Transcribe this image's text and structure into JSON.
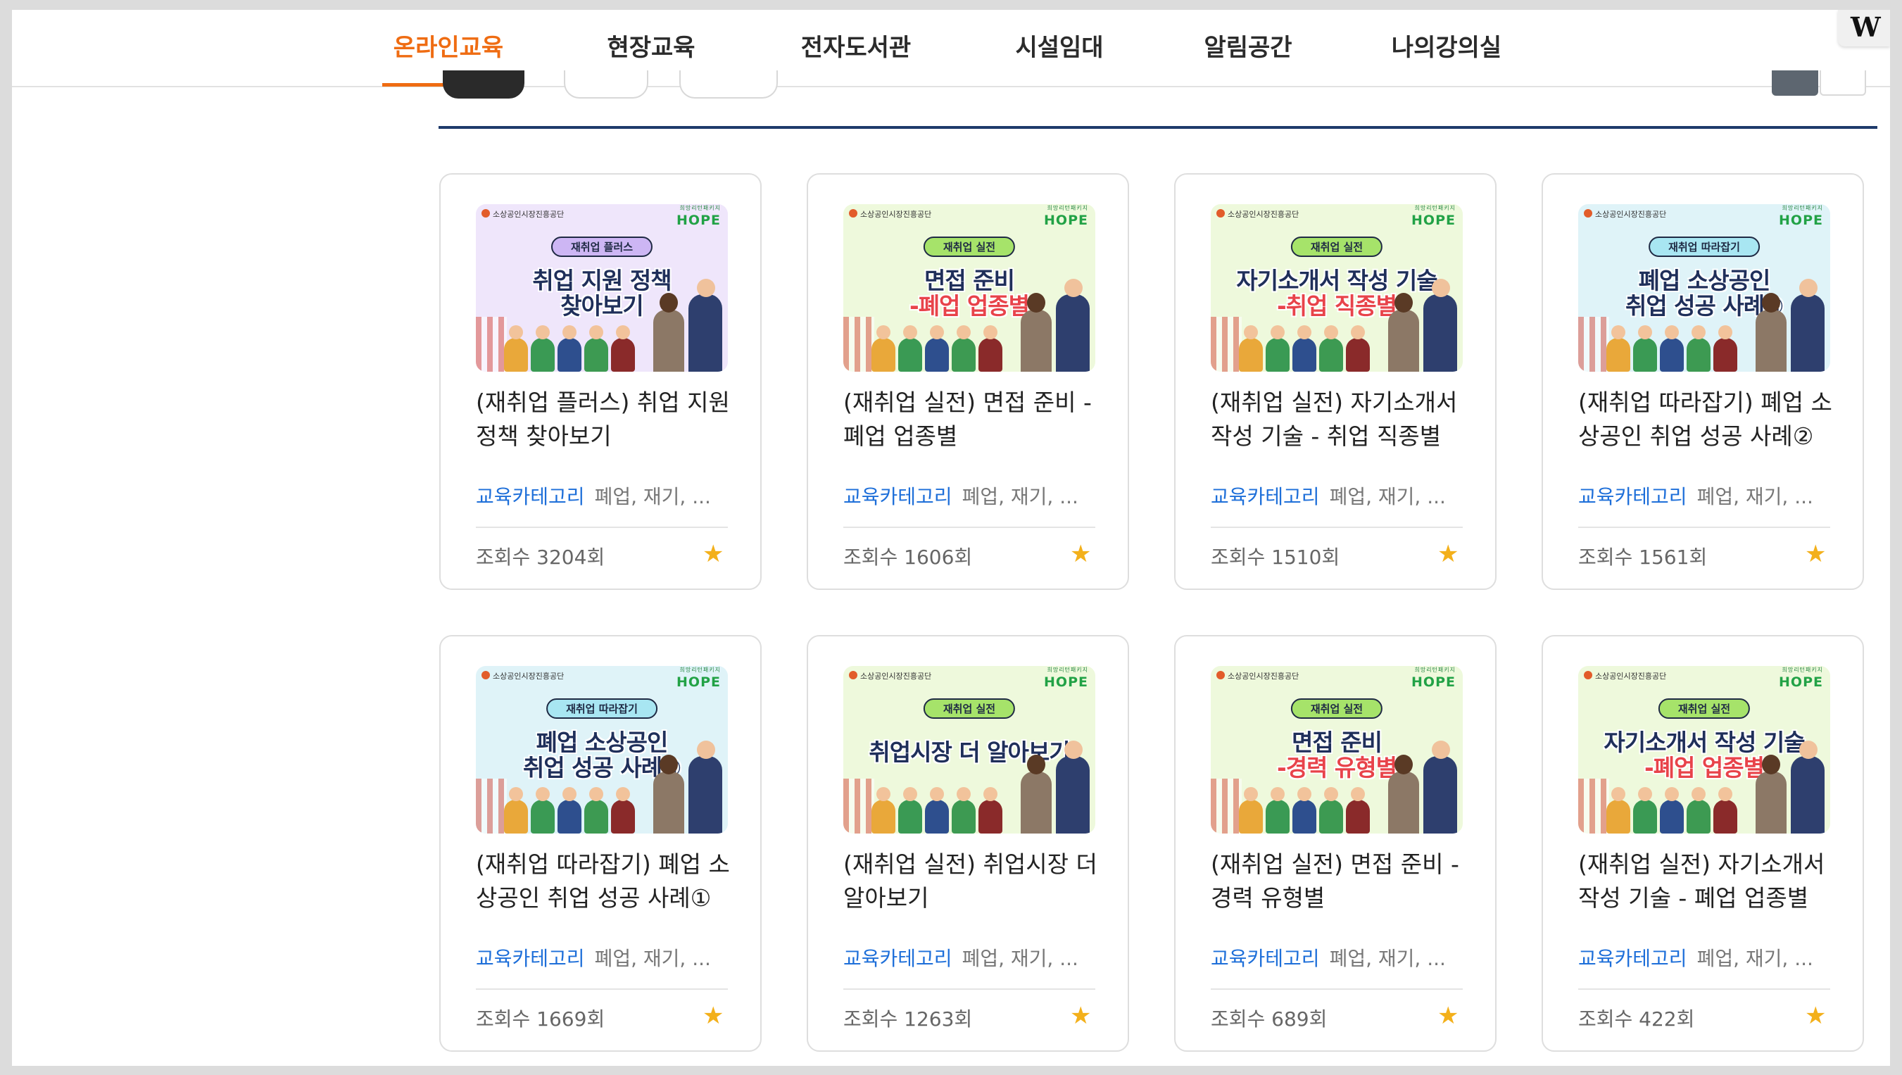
{
  "nav": {
    "items": [
      {
        "label": "온라인교육",
        "active": true
      },
      {
        "label": "현장교육",
        "active": false
      },
      {
        "label": "전자도서관",
        "active": false
      },
      {
        "label": "시설임대",
        "active": false
      },
      {
        "label": "알림공간",
        "active": false
      },
      {
        "label": "나의강의실",
        "active": false
      }
    ],
    "active_color": "#ef6c12"
  },
  "corner_logo": "W",
  "thumbnail_common": {
    "org": "소상공인시장진흥공단",
    "brand": "HOPE",
    "brand_sub": "희망리턴패키지"
  },
  "cards": [
    {
      "thumb_tag": "재취업 플러스",
      "thumb_line1": "취업 지원 정책",
      "thumb_line2": "찾아보기",
      "thumb_bg": "#efe6fb",
      "title": "(재취업 플러스) 취업 지원 정책 찾아보기",
      "category": "교육카테고리",
      "tags": "폐업, 재기, ...",
      "views": "조회수 3204회",
      "favorite": true
    },
    {
      "thumb_tag": "재취업 실전",
      "thumb_line1": "면접 준비",
      "thumb_line2": "-폐업 업종별",
      "thumb_bg": "#eef9dc",
      "title": "(재취업 실전) 면접 준비 - 폐업 업종별",
      "category": "교육카테고리",
      "tags": "폐업, 재기, ...",
      "views": "조회수 1606회",
      "favorite": true
    },
    {
      "thumb_tag": "재취업 실전",
      "thumb_line1": "자기소개서 작성 기술",
      "thumb_line2": "-취업 직종별",
      "thumb_bg": "#eef9dc",
      "title": "(재취업 실전) 자기소개서 작성 기술 - 취업 직종별",
      "category": "교육카테고리",
      "tags": "폐업, 재기, ...",
      "views": "조회수 1510회",
      "favorite": true
    },
    {
      "thumb_tag": "재취업 따라잡기",
      "thumb_line1": "폐업 소상공인",
      "thumb_line2": "취업 성공 사례②",
      "thumb_bg": "#dff3f8",
      "title": "(재취업 따라잡기) 폐업 소상공인 취업 성공 사례②",
      "category": "교육카테고리",
      "tags": "폐업, 재기, ...",
      "views": "조회수 1561회",
      "favorite": true
    },
    {
      "thumb_tag": "재취업 따라잡기",
      "thumb_line1": "폐업 소상공인",
      "thumb_line2": "취업 성공 사례①",
      "thumb_bg": "#dff3f8",
      "title": "(재취업 따라잡기) 폐업 소상공인 취업 성공 사례①",
      "category": "교육카테고리",
      "tags": "폐업, 재기, ...",
      "views": "조회수 1669회",
      "favorite": true
    },
    {
      "thumb_tag": "재취업 실전",
      "thumb_line1": "취업시장 더 알아보기",
      "thumb_line2": "",
      "thumb_bg": "#eef9dc",
      "title": "(재취업 실전) 취업시장 더 알아보기",
      "category": "교육카테고리",
      "tags": "폐업, 재기, ...",
      "views": "조회수 1263회",
      "favorite": true
    },
    {
      "thumb_tag": "재취업 실전",
      "thumb_line1": "면접 준비",
      "thumb_line2": "-경력 유형별",
      "thumb_bg": "#eef9dc",
      "title": "(재취업 실전) 면접 준비 - 경력 유형별",
      "category": "교육카테고리",
      "tags": "폐업, 재기, ...",
      "views": "조회수 689회",
      "favorite": true
    },
    {
      "thumb_tag": "재취업 실전",
      "thumb_line1": "자기소개서 작성 기술",
      "thumb_line2": "-폐업 업종별",
      "thumb_bg": "#eef9dc",
      "title": "(재취업 실전) 자기소개서 작성 기술 - 폐업 업종별",
      "category": "교육카테고리",
      "tags": "폐업, 재기, ...",
      "views": "조회수 422회",
      "favorite": true
    }
  ],
  "colors": {
    "divider": "#1e3a6b",
    "category_link": "#1e6fd9",
    "star": "#f3b01b",
    "tag_bg": "#a6e36a",
    "tag_bg_plus": "#cdb6f4",
    "tag_bg_follow": "#a8e6f2"
  }
}
